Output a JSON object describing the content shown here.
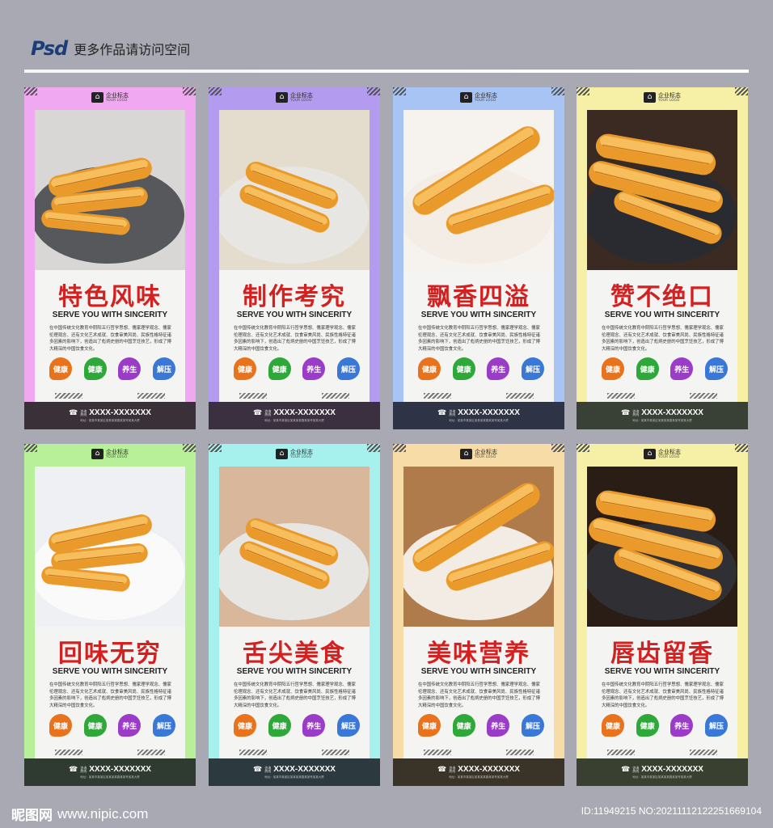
{
  "header": {
    "logo": "Psd",
    "text": "更多作品请访问空间"
  },
  "logo": {
    "cn": "企业标志",
    "en": "YOUR LOGO"
  },
  "subtitle": "SERVE YOU WITH SINCERITY",
  "body_text": "在中国传统文化教育中阴阳五行哲学思想、儒家理学观念、儒家伦理观念、还有文化艺术成就、饮食审美风尚、民族性格特征诸多因素的影响下，创造出了彪炳史册的中国烹饪技艺，形成了博大精深的中国饮食文化。",
  "badges": [
    {
      "label": "健康",
      "color": "#e8731c"
    },
    {
      "label": "健康",
      "color": "#2fa83a"
    },
    {
      "label": "养生",
      "color": "#9b3cc9"
    },
    {
      "label": "解压",
      "color": "#3a78d8"
    }
  ],
  "footer": {
    "phone_label_1": "咨询",
    "phone_label_2": "热线",
    "phone": "XXXX-XXXXXXX",
    "address": "地址：某某市某某区某某某某路某某号某某大厦"
  },
  "panels": [
    {
      "title": "特色风味",
      "frame": "#f0a8f0",
      "footer": "#3a3138",
      "photo_bg": "#d9d7d6",
      "plate": "#56585c"
    },
    {
      "title": "制作考究",
      "frame": "#b39cf0",
      "footer": "#3b3040",
      "photo_bg": "#e4dccd",
      "plate": "#e8e6e2"
    },
    {
      "title": "飘香四溢",
      "frame": "#a8c4f5",
      "footer": "#2e3346",
      "photo_bg": "#f6f2ee",
      "plate": "#f3ede6"
    },
    {
      "title": "赞不绝口",
      "frame": "#f5f0a6",
      "footer": "#394036",
      "photo_bg": "#3a2a22",
      "plate": "#2a2b30"
    },
    {
      "title": "回味无穷",
      "frame": "#b8f09a",
      "footer": "#2f3a31",
      "photo_bg": "#eef0f4",
      "plate": "#fafafa"
    },
    {
      "title": "舌尖美食",
      "frame": "#a6f0ee",
      "footer": "#2c3a3f",
      "photo_bg": "#d8b79a",
      "plate": "#e8e6e3"
    },
    {
      "title": "美味营养",
      "frame": "#f8dca8",
      "footer": "#3a3428",
      "photo_bg": "#b07b4a",
      "plate": "#f2ece4"
    },
    {
      "title": "唇齿留香",
      "frame": "#f5f0a6",
      "footer": "#39402f",
      "photo_bg": "#2a1d16",
      "plate": "#303034"
    }
  ],
  "watermark": {
    "left": "昵图网",
    "site": "www.nipic.com",
    "right": "ID:11949215 NO:20211112122251669104"
  }
}
